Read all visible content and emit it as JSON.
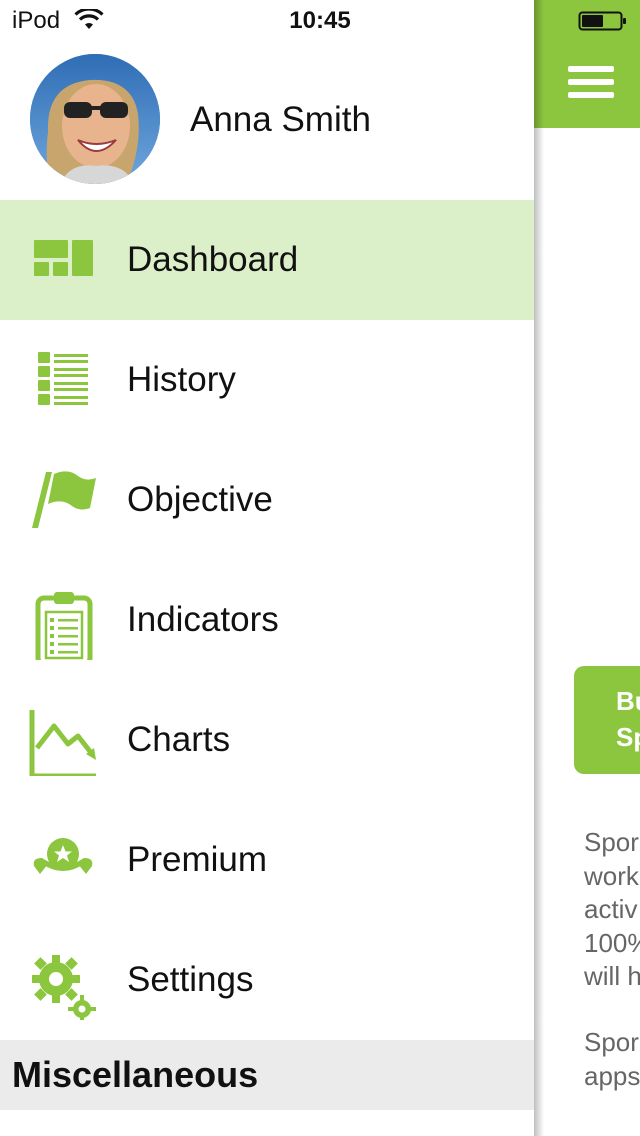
{
  "status_bar": {
    "carrier": "iPod",
    "time": "10:45"
  },
  "profile": {
    "name": "Anna Smith"
  },
  "menu": {
    "items": [
      {
        "label": "Dashboard",
        "icon": "dashboard-icon",
        "active": true
      },
      {
        "label": "History",
        "icon": "list-icon",
        "active": false
      },
      {
        "label": "Objective",
        "icon": "flag-icon",
        "active": false
      },
      {
        "label": "Indicators",
        "icon": "clipboard-icon",
        "active": false
      },
      {
        "label": "Charts",
        "icon": "chart-icon",
        "active": false
      },
      {
        "label": "Premium",
        "icon": "ribbon-badge-icon",
        "active": false
      },
      {
        "label": "Settings",
        "icon": "gear-icon",
        "active": false
      }
    ],
    "section_title": "Miscellaneous"
  },
  "main": {
    "buy_button": {
      "line1": "Bu",
      "line2": "Sp"
    },
    "description_lines": [
      "Spor",
      "work",
      "activ",
      "100%",
      "will h"
    ],
    "description2_lines": [
      "Spor",
      "apps"
    ]
  },
  "colors": {
    "accent": "#8cc63f",
    "active_row": "#dbefc9",
    "section_bg": "#ebebeb"
  }
}
